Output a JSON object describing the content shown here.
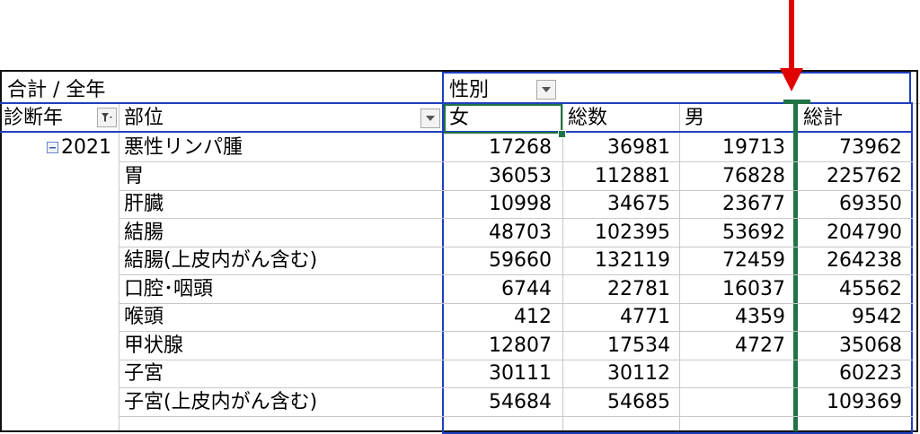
{
  "pivot": {
    "title": "合計 / 全年",
    "column_field": "性別",
    "row_field_year": "診断年",
    "row_field_site": "部位",
    "col_headers": [
      "女",
      "総数",
      "男",
      "総計"
    ],
    "year": "2021",
    "rows": [
      {
        "site": "悪性リンパ腫",
        "f": "17268",
        "t": "36981",
        "m": "19713",
        "g": "73962"
      },
      {
        "site": "胃",
        "f": "36053",
        "t": "112881",
        "m": "76828",
        "g": "225762"
      },
      {
        "site": "肝臓",
        "f": "10998",
        "t": "34675",
        "m": "23677",
        "g": "69350"
      },
      {
        "site": "結腸",
        "f": "48703",
        "t": "102395",
        "m": "53692",
        "g": "204790"
      },
      {
        "site": "結腸(上皮内がん含む)",
        "f": "59660",
        "t": "132119",
        "m": "72459",
        "g": "264238"
      },
      {
        "site": "口腔･咽頭",
        "f": "6744",
        "t": "22781",
        "m": "16037",
        "g": "45562"
      },
      {
        "site": "喉頭",
        "f": "412",
        "t": "4771",
        "m": "4359",
        "g": "9542"
      },
      {
        "site": "甲状腺",
        "f": "12807",
        "t": "17534",
        "m": "4727",
        "g": "35068"
      },
      {
        "site": "子宮",
        "f": "30111",
        "t": "30112",
        "m": "",
        "g": "60223"
      },
      {
        "site": "子宮(上皮内がん含む)",
        "f": "54684",
        "t": "54685",
        "m": "",
        "g": "109369"
      }
    ]
  },
  "colors": {
    "pivot_border": "#1f3fbf",
    "selection": "#217346",
    "arrow": "#e00000"
  },
  "icons": {
    "expand_collapse": "minus-box-icon",
    "filter": "filter-icon",
    "dropdown": "dropdown-arrow-icon",
    "annotation": "red-down-arrow-icon"
  }
}
